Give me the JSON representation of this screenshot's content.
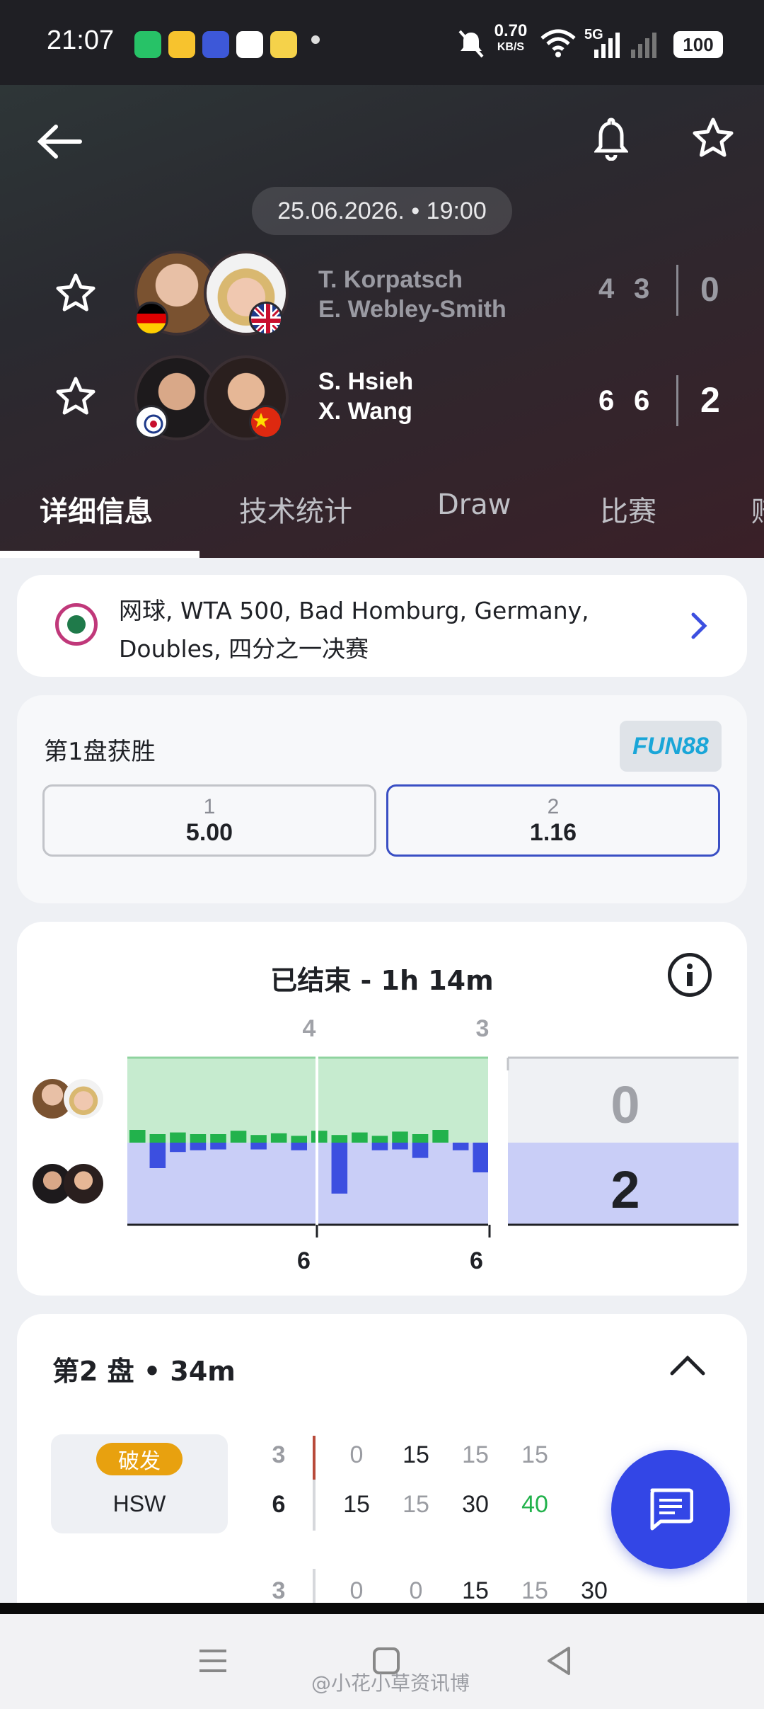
{
  "status_bar": {
    "time": "21:07",
    "net_speed_value": "0.70",
    "net_speed_unit": "KB/S",
    "network": "5G",
    "battery": "100"
  },
  "match": {
    "datetime": "25.06.2026. • 19:00",
    "team1": {
      "player1": "T. Korpatsch",
      "player2": "E. Webley-Smith",
      "set_scores": [
        "4",
        "3"
      ],
      "sets_won": "0"
    },
    "team2": {
      "player1": "S. Hsieh",
      "player2": "X. Wang",
      "set_scores": [
        "6",
        "6"
      ],
      "sets_won": "2"
    }
  },
  "tabs": [
    "详细信息",
    "技术统计",
    "Draw",
    "比赛",
    "赔"
  ],
  "competition": {
    "line1": "网球, WTA 500, Bad Homburg, Germany,",
    "line2": "Doubles, 四分之一决赛"
  },
  "odds": {
    "title": "第1盘获胜",
    "brand": "FUN88",
    "options": [
      {
        "key": "1",
        "value": "5.00"
      },
      {
        "key": "2",
        "value": "1.16"
      }
    ]
  },
  "momentum": {
    "status": "已结束 - 1h 14m",
    "top_labels": [
      "4",
      "3"
    ],
    "bottom_labels": [
      "6",
      "6"
    ],
    "team1_sets": "0",
    "team2_sets": "2",
    "green_bars": [
      0.15,
      0.1,
      0.12,
      0.1,
      0.1,
      0.14,
      0.09,
      0.11,
      0.08,
      0.14,
      0.09,
      0.12,
      0.08,
      0.13,
      0.1,
      0.15
    ],
    "blue_bars": [
      0.0,
      0.3,
      0.11,
      0.09,
      0.08,
      0.0,
      0.08,
      0.0,
      0.09,
      0.0,
      0.6,
      0.0,
      0.09,
      0.08,
      0.18,
      0.0,
      0.09,
      0.35
    ],
    "colors": {
      "green_fill": "#c6ebcf",
      "blue_fill": "#c9cef7",
      "green_bar": "#22b24c",
      "blue_bar": "#3c4fe0"
    }
  },
  "set_detail": {
    "title": "第2 盘 • 34m",
    "game_rows": [
      {
        "badge": "破发",
        "server": "HSW",
        "team1_games": "3",
        "team2_games": "6",
        "team1_points": [
          "0",
          "15",
          "15",
          "15"
        ],
        "team2_points": [
          "15",
          "15",
          "30",
          "40"
        ]
      },
      {
        "team1_games": "3",
        "team1_points": [
          "0",
          "0",
          "15",
          "15",
          "30"
        ]
      }
    ]
  },
  "watermark": "@小花小草资讯博"
}
